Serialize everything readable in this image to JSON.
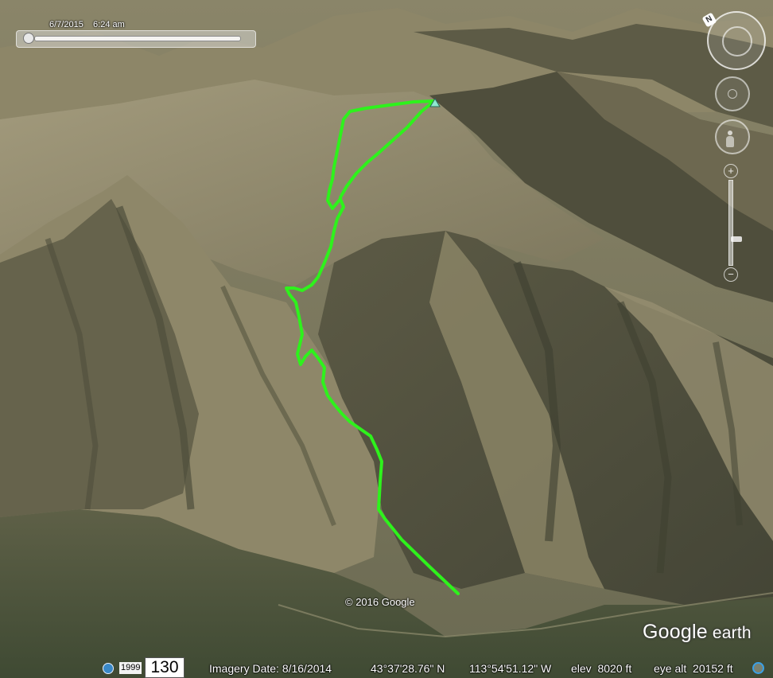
{
  "time_slider": {
    "label": "6/7/2015    6:24 am"
  },
  "navigation": {
    "compass_label": "N",
    "zoom_in_label": "+",
    "zoom_out_label": "−"
  },
  "map": {
    "copyright": "© 2016 Google",
    "logo_main": "Google",
    "logo_sub": " earth",
    "track_color": "#2ef21c",
    "summit_marker_color": "#8fe8d0",
    "track_description": "hiking route ascending from valley to summit"
  },
  "status_bar": {
    "year_badge": "1999",
    "scale_badge": "130",
    "imagery_date": "Imagery Date: 8/16/2014",
    "latitude": "43°37'28.76\" N",
    "longitude": "113°54'51.12\" W",
    "elevation": "elev  8020 ft",
    "eye_altitude": "eye alt  20152 ft"
  },
  "icons": {
    "globe": "globe-icon",
    "streaming": "streaming-icon",
    "compass": "compass-icon",
    "pegman": "pegman-icon"
  }
}
